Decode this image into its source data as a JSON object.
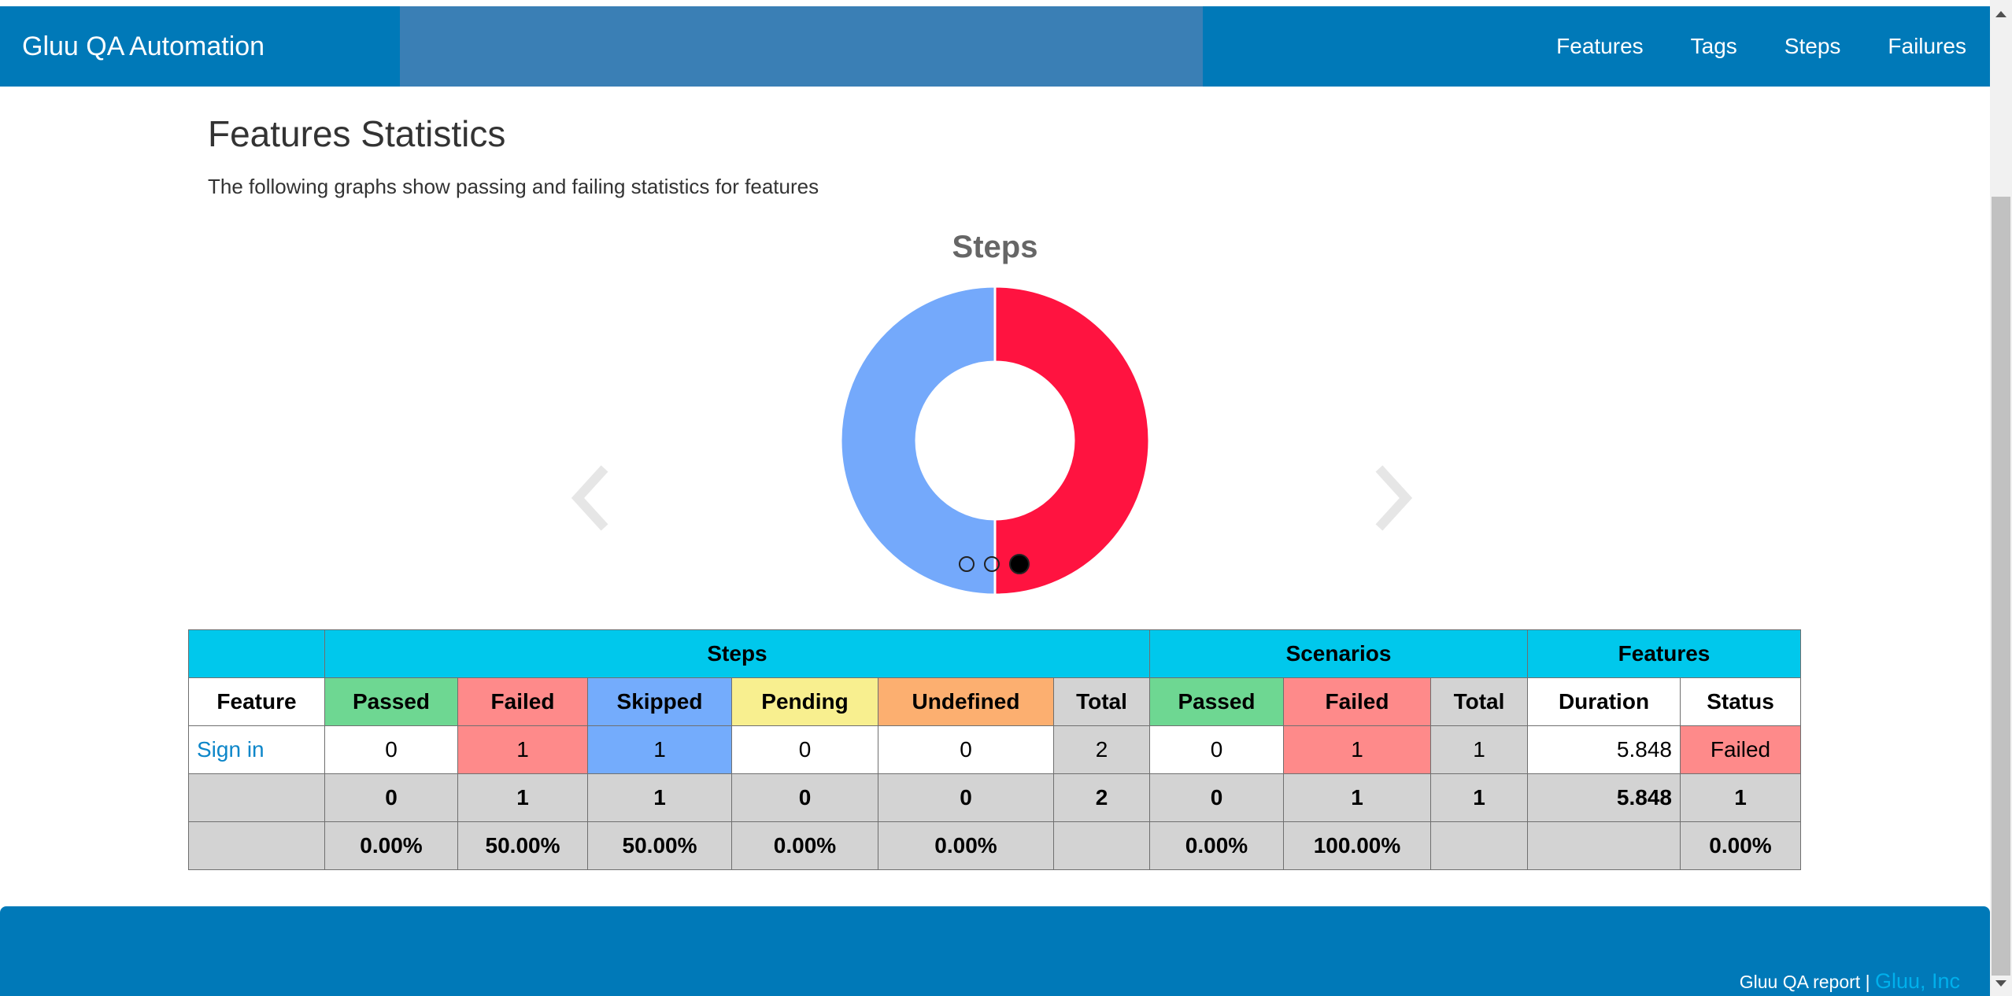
{
  "nav": {
    "brand": "Gluu QA Automation",
    "links": [
      "Features",
      "Tags",
      "Steps",
      "Failures"
    ]
  },
  "page": {
    "title": "Features Statistics",
    "subtitle": "The following graphs show passing and failing statistics for features"
  },
  "chart_data": {
    "type": "pie",
    "title": "Steps",
    "slices": [
      {
        "label": "Failed",
        "value": 1,
        "color": "#ff1340"
      },
      {
        "label": "Skipped",
        "value": 1,
        "color": "#74a9fb"
      }
    ]
  },
  "carousel": {
    "slide_count": 3,
    "active_index": 2
  },
  "table": {
    "group_headers": {
      "steps": "Steps",
      "scenarios": "Scenarios",
      "features": "Features"
    },
    "column_headers": [
      "Feature",
      "Passed",
      "Failed",
      "Skipped",
      "Pending",
      "Undefined",
      "Total",
      "Passed",
      "Failed",
      "Total",
      "Duration",
      "Status"
    ],
    "rows": [
      {
        "feature": "Sign in",
        "cells": [
          "0",
          "1",
          "1",
          "0",
          "0",
          "2",
          "0",
          "1",
          "1",
          "5.848",
          "Failed"
        ]
      }
    ],
    "totals": [
      "",
      "0",
      "1",
      "1",
      "0",
      "0",
      "2",
      "0",
      "1",
      "1",
      "5.848",
      "1"
    ],
    "percentages": [
      "",
      "0.00%",
      "50.00%",
      "50.00%",
      "0.00%",
      "0.00%",
      "",
      "0.00%",
      "100.00%",
      "",
      "",
      "0.00%"
    ]
  },
  "footer": {
    "text": "Gluu QA report |",
    "link": "Gluu, Inc"
  },
  "icons": {
    "prev": "chevron-left-icon",
    "next": "chevron-right-icon"
  }
}
